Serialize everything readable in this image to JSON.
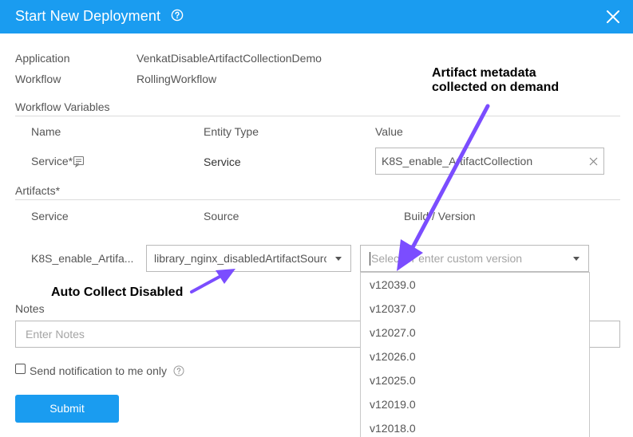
{
  "dialog": {
    "title": "Start New Deployment",
    "help_icon": "question-circle-icon",
    "close_icon": "close-x-icon"
  },
  "summary": {
    "application_label": "Application",
    "application_value": "VenkatDisableArtifactCollectionDemo",
    "workflow_label": "Workflow",
    "workflow_value": "RollingWorkflow"
  },
  "workflow_variables": {
    "section_title": "Workflow Variables",
    "columns": [
      "Name",
      "Entity Type",
      "Value"
    ],
    "row": {
      "name": "Service*",
      "name_icon": "notes-icon",
      "entity_type": "Service",
      "value": "K8S_enable_ArtifactCollection",
      "clear_icon": "clear-x-icon"
    }
  },
  "artifacts": {
    "section_title": "Artifacts*",
    "columns": [
      "Service",
      "Source",
      "Build / Version"
    ],
    "row": {
      "service": "K8S_enable_Artifa...",
      "source": "library_nginx_disabledArtifactSource",
      "version_placeholder": "Select or enter custom version"
    },
    "version_options": [
      "v12039.0",
      "v12037.0",
      "v12027.0",
      "v12026.0",
      "v12025.0",
      "v12019.0",
      "v12018.0"
    ]
  },
  "notes": {
    "label": "Notes",
    "placeholder": "Enter Notes"
  },
  "notification": {
    "label": "Send notification to me only",
    "checked": false,
    "help_icon": "question-circle-icon"
  },
  "submit_label": "Submit",
  "annotations": {
    "metadata_line1": "Artifact metadata",
    "metadata_line2": "collected on demand",
    "auto_collect": "Auto Collect Disabled",
    "arrow_color": "#7b4dff"
  },
  "colors": {
    "header": "#1a9cf0",
    "submit": "#1a9cf0"
  }
}
